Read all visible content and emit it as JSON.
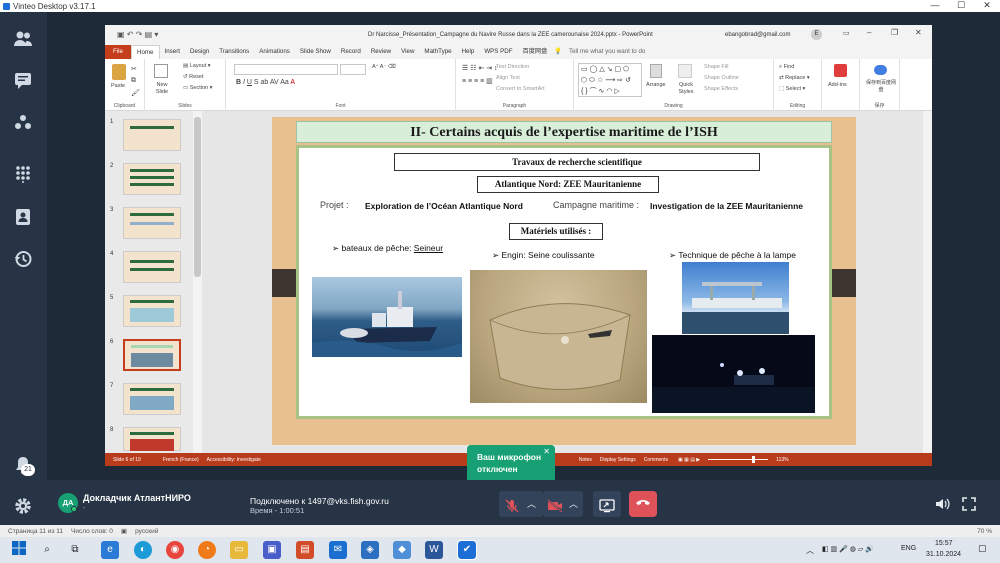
{
  "window": {
    "title": "Vinteo Desktop v3.17.1"
  },
  "sidebar": {
    "badge_count": "21"
  },
  "powerpoint": {
    "doc_title": "Dr Narcisse_Présentation_Campagne du Navire Russe dans la ZEE camerounaise 2024.pptx  -  PowerPoint",
    "user_email": "ebangobrad@gmail.com",
    "tabs": [
      "File",
      "Home",
      "Insert",
      "Design",
      "Transitions",
      "Animations",
      "Slide Show",
      "Record",
      "Review",
      "View",
      "MathType",
      "Help",
      "WPS PDF",
      "百度网盘",
      "Tell me what you want to do"
    ],
    "ribbon": {
      "clipboard_label": "Clipboard",
      "paste": "Paste",
      "slides_label": "Slides",
      "new_slide": "New Slide",
      "layout": "Layout",
      "reset": "Reset",
      "section": "Section",
      "font_label": "Font",
      "paragraph_label": "Paragraph",
      "text_direction": "Text Direction",
      "align_text": "Align Text",
      "convert_smartart": "Convert to SmartArt",
      "drawing_label": "Drawing",
      "arrange": "Arrange",
      "quick_styles": "Quick Styles",
      "shape_fill": "Shape Fill",
      "shape_outline": "Shape Outline",
      "shape_effects": "Shape Effects",
      "editing_label": "Editing",
      "find": "Find",
      "replace": "Replace",
      "select": "Select",
      "addins": "Add-ins",
      "baidu_save": "保存到百度网盘",
      "save_label": "保存"
    },
    "thumb_numbers": [
      "1",
      "2",
      "3",
      "4",
      "5",
      "6",
      "7",
      "8"
    ],
    "status": {
      "slide": "Slide 6 of 19",
      "lang": "French (France)",
      "accessibility": "Accessibility: Investigate",
      "notes": "Notes",
      "display": "Display Settings",
      "comments": "Comments",
      "zoom": "113%"
    }
  },
  "slide": {
    "title": "II- Certains acquis de l’expertise maritime de l’ISH",
    "box1": "Travaux de recherche scientifique",
    "box2": "Atlantique Nord: ZEE Mauritanienne",
    "projet_label": "Projet :",
    "projet_value": "Exploration de l’Océan Atlantique Nord",
    "campagne_label": "Campagne maritime :",
    "campagne_value": "Investigation de la ZEE Mauritanienne",
    "box3": "Matériels utilisés :",
    "item1_label": "bateaux de pêche: ",
    "item1_link": "Seineur",
    "item2": "Engin: Seine coulissante",
    "item3": "Technique de pêche à la lampe"
  },
  "popup": {
    "line1": "Ваш микрофон",
    "line2": "отключен"
  },
  "call": {
    "avatar_initials": "ДА",
    "participant_name": "Докладчик АтлантНИРО",
    "participant_sub": "-",
    "connected": "Подключено к 1497@vks.fish.gov.ru",
    "time": "Время - 1:00:51"
  },
  "app_status": {
    "page": "Страница 11 из 11",
    "words": "Число слов: 0",
    "lang": "русский",
    "zoom": "70 %"
  },
  "tray": {
    "lang": "ENG",
    "time": "15:57",
    "date": "31.10.2024"
  },
  "colors": {
    "sidebar": "#273445",
    "accent": "#17a073",
    "hangup": "#e0525a",
    "ppt_red": "#c43e1c"
  }
}
